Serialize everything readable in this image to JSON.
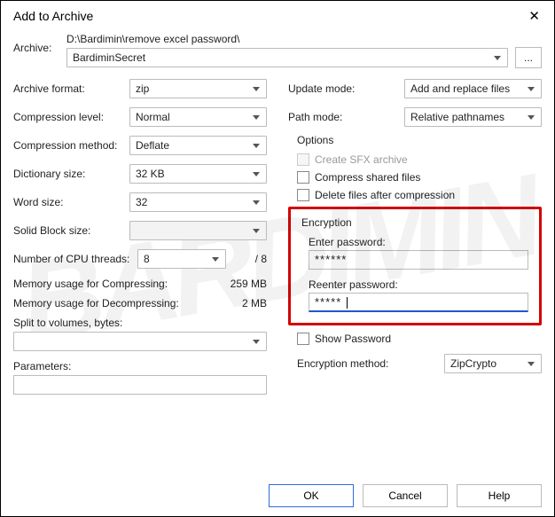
{
  "window": {
    "title": "Add to Archive"
  },
  "archive": {
    "label": "Archive:",
    "path": "D:\\Bardimin\\remove excel password\\",
    "name": "BardiminSecret",
    "browse": "..."
  },
  "left": {
    "format_label": "Archive format:",
    "format_value": "zip",
    "level_label": "Compression level:",
    "level_value": "Normal",
    "method_label": "Compression method:",
    "method_value": "Deflate",
    "dict_label": "Dictionary size:",
    "dict_value": "32 KB",
    "word_label": "Word size:",
    "word_value": "32",
    "solid_label": "Solid Block size:",
    "solid_value": "",
    "cpu_label": "Number of CPU threads:",
    "cpu_value": "8",
    "cpu_total": "/ 8",
    "mem_comp_label": "Memory usage for Compressing:",
    "mem_comp_value": "259 MB",
    "mem_decomp_label": "Memory usage for Decompressing:",
    "mem_decomp_value": "2 MB",
    "split_label": "Split to volumes, bytes:",
    "split_value": "",
    "params_label": "Parameters:",
    "params_value": ""
  },
  "right": {
    "update_label": "Update mode:",
    "update_value": "Add and replace files",
    "path_label": "Path mode:",
    "path_value": "Relative pathnames",
    "options_title": "Options",
    "opt_sfx": "Create SFX archive",
    "opt_shared": "Compress shared files",
    "opt_delete": "Delete files after compression",
    "enc_title": "Encryption",
    "enter_pw": "Enter password:",
    "pw1": "******",
    "reenter_pw": "Reenter password:",
    "pw2": "*****",
    "show_pw": "Show Password",
    "enc_method_label": "Encryption method:",
    "enc_method_value": "ZipCrypto"
  },
  "buttons": {
    "ok": "OK",
    "cancel": "Cancel",
    "help": "Help"
  }
}
